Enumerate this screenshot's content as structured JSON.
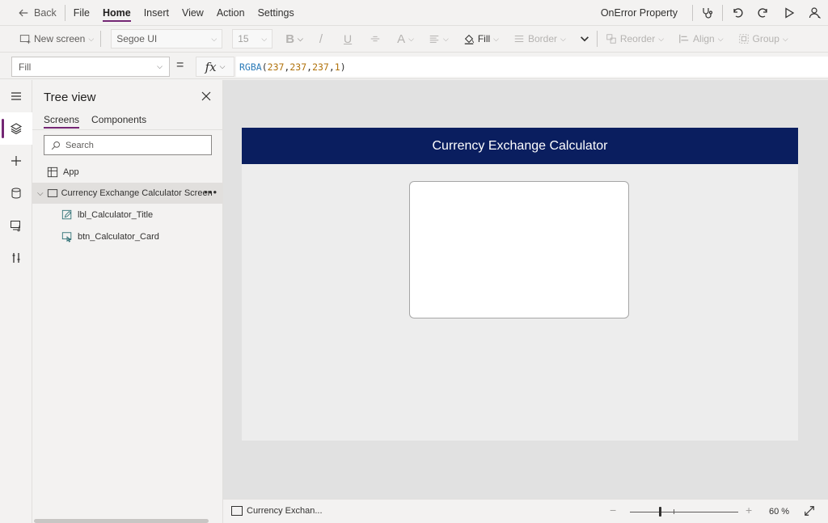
{
  "menu": {
    "back_label": "Back",
    "items": [
      "File",
      "Home",
      "Insert",
      "View",
      "Action",
      "Settings"
    ],
    "active": "Home",
    "onerror_label": "OnError Property",
    "icons": [
      "stethoscope-icon",
      "undo-icon",
      "redo-icon",
      "play-icon",
      "user-icon"
    ]
  },
  "ribbon": {
    "new_screen_label": "New screen",
    "font_family": "Segoe UI",
    "font_size": "15",
    "bold_label": "B",
    "italic_label": "/",
    "underline_label": "U",
    "font_color_label": "A",
    "fill_label": "Fill",
    "border_label": "Border",
    "reorder_label": "Reorder",
    "align_label": "Align",
    "group_label": "Group"
  },
  "formula_bar": {
    "property": "Fill",
    "equals": "=",
    "fx_label": "fx",
    "formula": {
      "func": "RGBA",
      "args": [
        "237",
        "237",
        "237",
        "1"
      ]
    }
  },
  "rail": {
    "items": [
      "hamburger-icon",
      "layers-icon",
      "plus-icon",
      "database-icon",
      "media-icon",
      "tools-icon"
    ],
    "active": "layers-icon"
  },
  "tree_view": {
    "title": "Tree view",
    "tabs": [
      "Screens",
      "Components"
    ],
    "active_tab": "Screens",
    "search_placeholder": "Search",
    "app_label": "App",
    "screen_label": "Currency Exchange Calculator Screen",
    "children": [
      "lbl_Calculator_Title",
      "btn_Calculator_Card"
    ]
  },
  "canvas": {
    "header_title": "Currency Exchange Calculator",
    "header_color": "#0a1e5f",
    "screen_fill": "#ededed"
  },
  "status_bar": {
    "screen_name": "Currency Exchan...",
    "zoom_minus": "−",
    "zoom_plus": "+",
    "zoom_value": "60 %",
    "zoom_level_percent": 60
  },
  "colors": {
    "accent": "#742774",
    "formula_func": "#2b7bb9",
    "formula_number": "#b0720b"
  }
}
